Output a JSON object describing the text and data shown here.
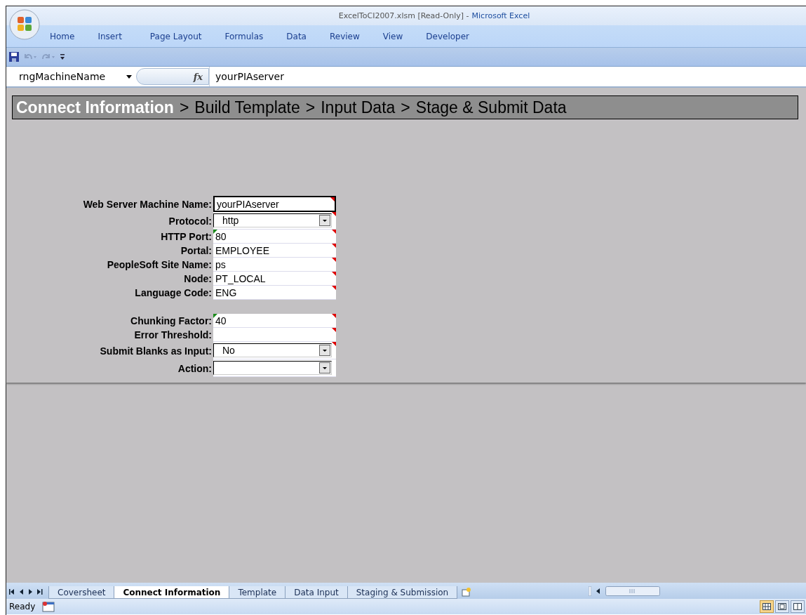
{
  "window": {
    "document": "ExcelToCI2007.xlsm  [Read-Only] -",
    "app": "Microsoft Excel"
  },
  "ribbon_tabs": [
    "Home",
    "Insert",
    "Page Layout",
    "Formulas",
    "Data",
    "Review",
    "View",
    "Developer"
  ],
  "formula_bar": {
    "name_box": "rngMachineName",
    "fx": "fx",
    "value": "yourPIAserver"
  },
  "breadcrumb": {
    "separator": ">",
    "steps": [
      {
        "label": "Connect Information",
        "selected": true
      },
      {
        "label": "Build Template",
        "selected": false
      },
      {
        "label": "Input Data",
        "selected": false
      },
      {
        "label": "Stage & Submit Data",
        "selected": false
      }
    ]
  },
  "form": [
    {
      "kind": "text",
      "label": "Web Server Machine Name:",
      "value": "yourPIAserver",
      "selected": true,
      "comment": true,
      "warning": false
    },
    {
      "kind": "dropdown",
      "label": "Protocol:",
      "value": "http",
      "selected": false,
      "comment": true,
      "warning": false
    },
    {
      "kind": "text",
      "label": "HTTP Port:",
      "value": "80",
      "selected": false,
      "comment": true,
      "warning": true
    },
    {
      "kind": "text",
      "label": "Portal:",
      "value": "EMPLOYEE",
      "selected": false,
      "comment": true,
      "warning": false
    },
    {
      "kind": "text",
      "label": "PeopleSoft Site Name:",
      "value": "ps",
      "selected": false,
      "comment": true,
      "warning": false
    },
    {
      "kind": "text",
      "label": "Node:",
      "value": "PT_LOCAL",
      "selected": false,
      "comment": true,
      "warning": false
    },
    {
      "kind": "text",
      "label": "Language Code:",
      "value": "ENG",
      "selected": false,
      "comment": true,
      "warning": false
    },
    {
      "kind": "spacer"
    },
    {
      "kind": "text",
      "label": "Chunking Factor:",
      "value": "40",
      "selected": false,
      "comment": true,
      "warning": true
    },
    {
      "kind": "text",
      "label": "Error Threshold:",
      "selected": false,
      "comment": true,
      "warning": false
    },
    {
      "kind": "dropdown",
      "label": "Submit Blanks as Input:",
      "value": "No",
      "selected": false,
      "comment": true,
      "warning": false
    },
    {
      "kind": "dropdown",
      "label": "Action:",
      "selected": false,
      "comment": false,
      "warning": false
    }
  ],
  "sheet_tabs": [
    {
      "label": "Coversheet",
      "selected": false
    },
    {
      "label": "Connect Information",
      "selected": true
    },
    {
      "label": "Template",
      "selected": false
    },
    {
      "label": "Data Input",
      "selected": false
    },
    {
      "label": "Staging & Submission",
      "selected": false
    }
  ],
  "status_bar": {
    "text": "Ready",
    "views": [
      {
        "selected": true
      },
      {
        "selected": false
      },
      {
        "selected": false
      }
    ]
  }
}
